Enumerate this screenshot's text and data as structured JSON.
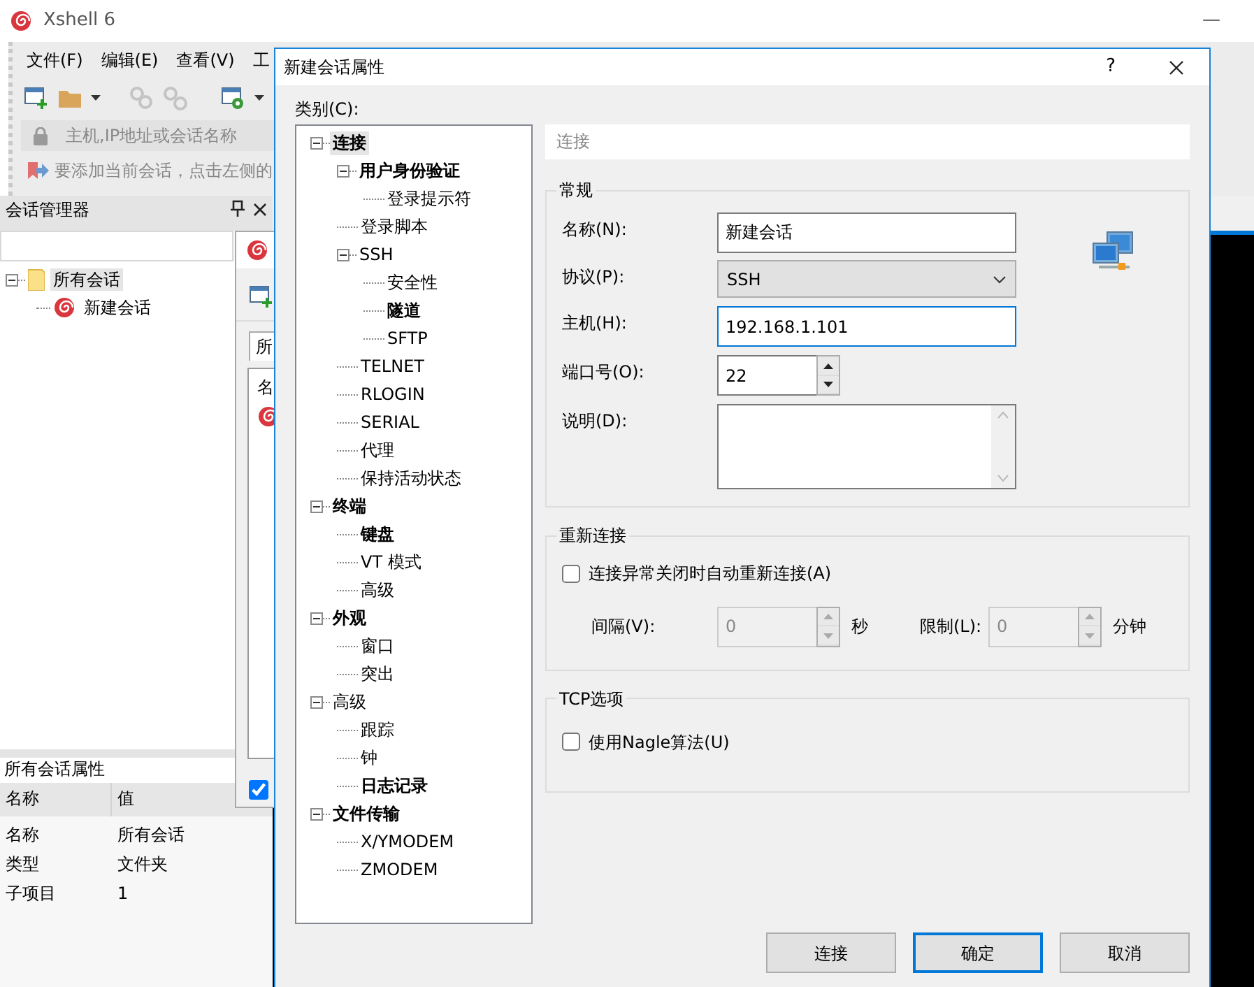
{
  "main_window": {
    "title": "Xshell 6",
    "minimize": "—"
  },
  "menu": [
    "文件(F)",
    "编辑(E)",
    "查看(V)",
    "工"
  ],
  "address_bar": {
    "placeholder": "主机,IP地址或会话名称"
  },
  "hint_bar": {
    "text": "要添加当前会话，点击左侧的"
  },
  "session_manager": {
    "title": "会话管理器",
    "tree": [
      {
        "label": "所有会话",
        "kind": "folder",
        "selected": true,
        "expanded": true,
        "children": [
          {
            "label": "新建会话",
            "kind": "session",
            "selected": false
          }
        ]
      }
    ]
  },
  "properties": {
    "title": "所有会话属性",
    "columns": [
      "名称",
      "值"
    ],
    "rows": [
      [
        "名称",
        "所有会话"
      ],
      [
        "类型",
        "文件夹"
      ],
      [
        "子项目",
        "1"
      ]
    ]
  },
  "background_window": {
    "tab": "所",
    "list_header": "名",
    "checked": true
  },
  "dialog": {
    "title": "新建会话属性",
    "help": "?",
    "category_label": "类别(C):",
    "tree": [
      {
        "label": "连接",
        "bold": true,
        "selected": true,
        "expanded": true,
        "children": [
          {
            "label": "用户身份验证",
            "bold": true,
            "selected": false,
            "expanded": true,
            "children": [
              {
                "label": "登录提示符",
                "bold": false,
                "selected": false
              }
            ]
          },
          {
            "label": "登录脚本",
            "bold": false,
            "selected": false
          },
          {
            "label": "SSH",
            "bold": false,
            "selected": false,
            "expanded": true,
            "children": [
              {
                "label": "安全性",
                "bold": false,
                "selected": false
              },
              {
                "label": "隧道",
                "bold": true,
                "selected": false
              },
              {
                "label": "SFTP",
                "bold": false,
                "selected": false
              }
            ]
          },
          {
            "label": "TELNET",
            "bold": false,
            "selected": false
          },
          {
            "label": "RLOGIN",
            "bold": false,
            "selected": false
          },
          {
            "label": "SERIAL",
            "bold": false,
            "selected": false
          },
          {
            "label": "代理",
            "bold": false,
            "selected": false
          },
          {
            "label": "保持活动状态",
            "bold": false,
            "selected": false
          }
        ]
      },
      {
        "label": "终端",
        "bold": true,
        "selected": false,
        "expanded": true,
        "children": [
          {
            "label": "键盘",
            "bold": true,
            "selected": false
          },
          {
            "label": "VT 模式",
            "bold": false,
            "selected": false
          },
          {
            "label": "高级",
            "bold": false,
            "selected": false
          }
        ]
      },
      {
        "label": "外观",
        "bold": true,
        "selected": false,
        "expanded": true,
        "children": [
          {
            "label": "窗口",
            "bold": false,
            "selected": false
          },
          {
            "label": "突出",
            "bold": false,
            "selected": false
          }
        ]
      },
      {
        "label": "高级",
        "bold": false,
        "selected": false,
        "expanded": true,
        "children": [
          {
            "label": "跟踪",
            "bold": false,
            "selected": false
          },
          {
            "label": "钟",
            "bold": false,
            "selected": false
          },
          {
            "label": "日志记录",
            "bold": true,
            "selected": false
          }
        ]
      },
      {
        "label": "文件传输",
        "bold": true,
        "selected": false,
        "expanded": true,
        "children": [
          {
            "label": "X/YMODEM",
            "bold": false,
            "selected": false
          },
          {
            "label": "ZMODEM",
            "bold": false,
            "selected": false
          }
        ]
      }
    ],
    "page_title": "连接",
    "general": {
      "title": "常规",
      "fields": [
        {
          "kind": "text",
          "label": "名称(N):",
          "value": "新建会话",
          "focused": false
        },
        {
          "kind": "select",
          "label": "协议(P):",
          "value": "SSH"
        },
        {
          "kind": "text",
          "label": "主机(H):",
          "value": "192.168.1.101",
          "focused": true
        },
        {
          "kind": "spin",
          "label": "端口号(O):",
          "value": "22"
        },
        {
          "kind": "textarea",
          "label": "说明(D):"
        }
      ]
    },
    "reconnect": {
      "title": "重新连接",
      "checkbox": {
        "label": "连接异常关闭时自动重新连接(A)",
        "checked": false
      },
      "spins": [
        {
          "label": "间隔(V):",
          "value": "0",
          "unit": "秒",
          "disabled": true
        },
        {
          "label": "限制(L):",
          "value": "0",
          "unit": "分钟",
          "disabled": true
        }
      ]
    },
    "tcp_options": {
      "title": "TCP选项",
      "checkbox": {
        "label": "使用Nagle算法(U)",
        "checked": false
      }
    },
    "buttons": [
      {
        "label": "连接",
        "default": false
      },
      {
        "label": "确定",
        "default": true
      },
      {
        "label": "取消",
        "default": false
      }
    ]
  }
}
